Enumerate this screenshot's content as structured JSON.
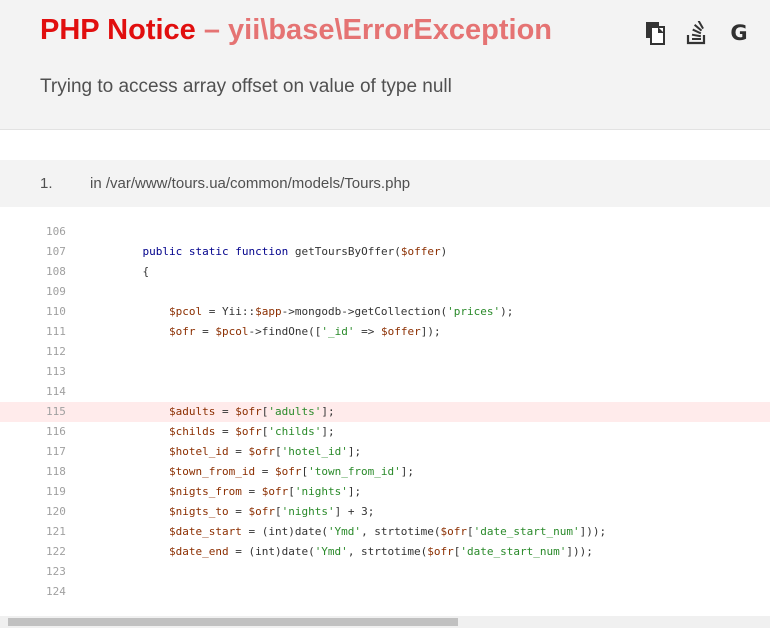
{
  "header": {
    "error_type": "PHP Notice",
    "dash": " – ",
    "error_name": "yii\\base\\ErrorException",
    "message": "Trying to access array offset on value of type null",
    "icons": [
      "copy-icon",
      "stackoverflow-icon",
      "google-icon"
    ],
    "google_letter": "G"
  },
  "frame": {
    "number": "1.",
    "file": "in /var/www/tours.ua/common/models/Tours.php"
  },
  "code": {
    "error_line": "115",
    "lines": [
      {
        "n": "106",
        "text": ""
      },
      {
        "n": "107",
        "text": "    public static function getToursByOffer($offer)"
      },
      {
        "n": "108",
        "text": "    {"
      },
      {
        "n": "109",
        "text": ""
      },
      {
        "n": "110",
        "text": "        $pcol = Yii::$app->mongodb->getCollection('prices');"
      },
      {
        "n": "111",
        "text": "        $ofr = $pcol->findOne(['_id' => $offer]);"
      },
      {
        "n": "112",
        "text": ""
      },
      {
        "n": "113",
        "text": ""
      },
      {
        "n": "114",
        "text": ""
      },
      {
        "n": "115",
        "text": "        $adults = $ofr['adults'];"
      },
      {
        "n": "116",
        "text": "        $childs = $ofr['childs'];"
      },
      {
        "n": "117",
        "text": "        $hotel_id = $ofr['hotel_id'];"
      },
      {
        "n": "118",
        "text": "        $town_from_id = $ofr['town_from_id'];"
      },
      {
        "n": "119",
        "text": "        $nigts_from = $ofr['nights'];"
      },
      {
        "n": "120",
        "text": "        $nigts_to = $ofr['nights'] + 3;"
      },
      {
        "n": "121",
        "text": "        $date_start = (int)date('Ymd', strtotime($ofr['date_start_num']));"
      },
      {
        "n": "122",
        "text": "        $date_end = (int)date('Ymd', strtotime($ofr['date_start_num']));"
      },
      {
        "n": "123",
        "text": ""
      },
      {
        "n": "124",
        "text": ""
      }
    ]
  },
  "colors": {
    "error_type": "#e10e0e",
    "error_name": "#e57373",
    "error_line_bg": "#ffebeb",
    "keyword": "#00008b",
    "variable": "#8b2e00",
    "string": "#2a8a2a"
  }
}
